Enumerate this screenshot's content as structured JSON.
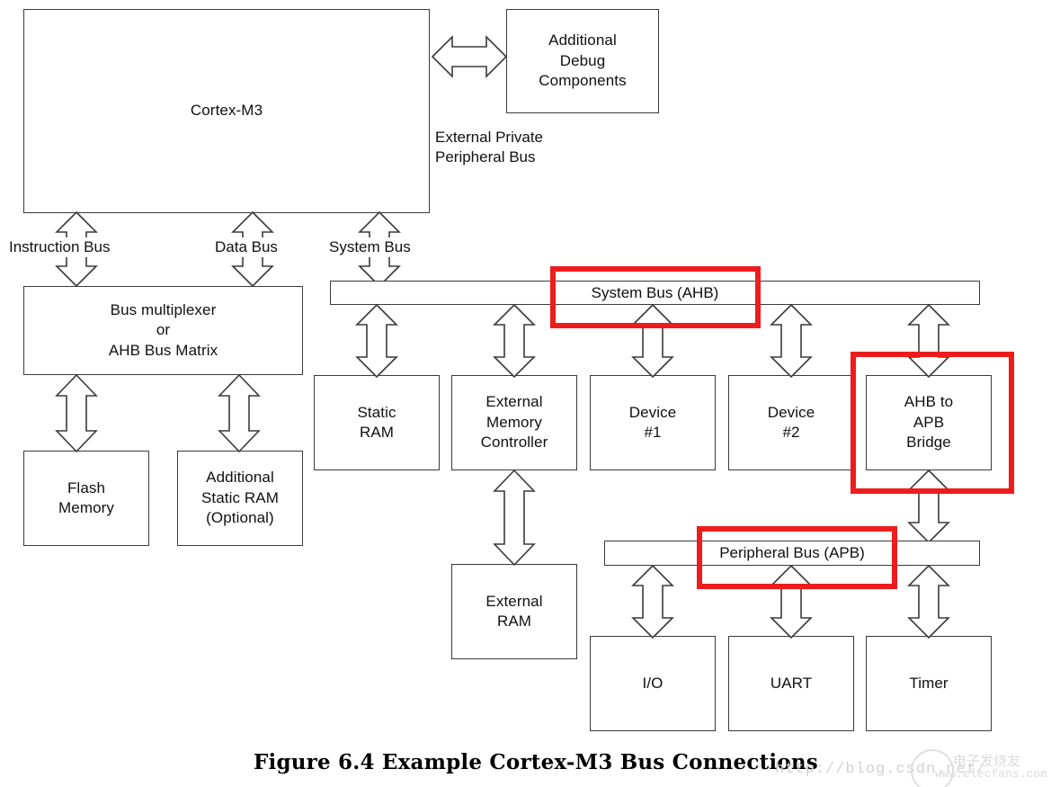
{
  "figure": {
    "caption": "Figure 6.4  Example Cortex-M3 Bus Connections",
    "highlight_color": "#ee1c1c",
    "line_color": "#3a3a3a",
    "background": "#ffffff"
  },
  "core": {
    "cortex_label": "Cortex-M3",
    "debug_label": "Additional\nDebug\nComponents",
    "ppb_label": "External Private\nPeripheral Bus"
  },
  "core_buses": {
    "instruction": "Instruction Bus",
    "data": "Data Bus",
    "system": "System Bus"
  },
  "left_column": {
    "mux_label": "Bus multiplexer\nor\nAHB Bus Matrix",
    "flash_label": "Flash\nMemory",
    "extra_sram_label": "Additional\nStatic RAM\n(Optional)"
  },
  "buses": {
    "system_bus": "System Bus (AHB)",
    "peripheral_bus": "Peripheral Bus (APB)"
  },
  "ahb_slaves": [
    {
      "label": "Static\nRAM"
    },
    {
      "label": "External\nMemory\nController"
    },
    {
      "label": "Device\n#1"
    },
    {
      "label": "Device\n#2"
    },
    {
      "label": "AHB to\nAPB\nBridge"
    }
  ],
  "external_ram": {
    "label": "External\nRAM"
  },
  "apb_slaves": [
    {
      "label": "I/O"
    },
    {
      "label": "UART"
    },
    {
      "label": "Timer"
    }
  ],
  "highlights": [
    {
      "name": "system-bus-highlight"
    },
    {
      "name": "ahb-to-apb-bridge-highlight"
    },
    {
      "name": "peripheral-bus-highlight"
    }
  ],
  "watermark": {
    "url_text": "http://blog.csdn.net/",
    "site_text": "www.elecfans.com",
    "brand_text": "电子发烧友"
  }
}
